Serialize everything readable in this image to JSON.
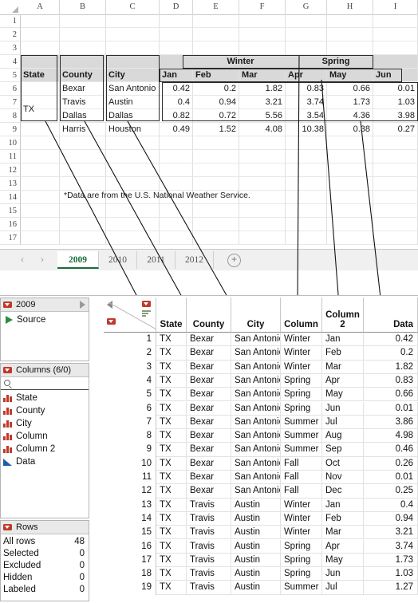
{
  "spreadsheet": {
    "column_headers": [
      "A",
      "B",
      "C",
      "D",
      "E",
      "F",
      "G",
      "H",
      "I"
    ],
    "row_headers": [
      "1",
      "2",
      "3",
      "4",
      "5",
      "6",
      "7",
      "8",
      "9",
      "10",
      "11",
      "12",
      "13",
      "14",
      "15",
      "16",
      "17"
    ],
    "season_headers": [
      {
        "label": "Winter"
      },
      {
        "label": "Spring"
      }
    ],
    "field_headers": [
      "State",
      "County",
      "City"
    ],
    "month_headers": [
      "Jan",
      "Feb",
      "Mar",
      "Apr",
      "May",
      "Jun"
    ],
    "state_value": "TX",
    "rows": [
      {
        "county": "Bexar",
        "city": "San Antonio",
        "values": [
          "0.42",
          "0.2",
          "1.82",
          "0.83",
          "0.66",
          "0.01"
        ]
      },
      {
        "county": "Travis",
        "city": "Austin",
        "values": [
          "0.4",
          "0.94",
          "3.21",
          "3.74",
          "1.73",
          "1.03"
        ]
      },
      {
        "county": "Dallas",
        "city": "Dallas",
        "values": [
          "0.82",
          "0.72",
          "5.56",
          "3.54",
          "4.36",
          "3.98"
        ]
      },
      {
        "county": "Harris",
        "city": "Houston",
        "values": [
          "0.49",
          "1.52",
          "4.08",
          "10.38",
          "0.38",
          "0.27"
        ]
      }
    ],
    "footnote": "*Data are from the U.S. National Weather Service.",
    "sheet_tabs": [
      {
        "label": "2009",
        "active": true
      },
      {
        "label": "2010",
        "active": false
      },
      {
        "label": "2011",
        "active": false
      },
      {
        "label": "2012",
        "active": false
      }
    ],
    "add_sheet_label": "+",
    "nav_prev": "‹",
    "nav_next": "›"
  },
  "jmp": {
    "table_panel": {
      "title": "2009",
      "source_label": "Source"
    },
    "columns_panel": {
      "title": "Columns (6/0)",
      "search_placeholder": "",
      "items": [
        {
          "name": "State",
          "type": "nominal"
        },
        {
          "name": "County",
          "type": "nominal"
        },
        {
          "name": "City",
          "type": "nominal"
        },
        {
          "name": "Column",
          "type": "nominal"
        },
        {
          "name": "Column 2",
          "type": "nominal"
        },
        {
          "name": "Data",
          "type": "continuous"
        }
      ]
    },
    "rows_panel": {
      "title": "Rows",
      "stats": [
        {
          "label": "All rows",
          "value": "48"
        },
        {
          "label": "Selected",
          "value": "0"
        },
        {
          "label": "Excluded",
          "value": "0"
        },
        {
          "label": "Hidden",
          "value": "0"
        },
        {
          "label": "Labeled",
          "value": "0"
        }
      ]
    },
    "grid": {
      "headers": [
        "State",
        "County",
        "City",
        "Column",
        "Column 2",
        "Data"
      ],
      "rows": [
        {
          "n": "1",
          "cells": [
            "TX",
            "Bexar",
            "San Antonio",
            "Winter",
            "Jan",
            "0.42"
          ]
        },
        {
          "n": "2",
          "cells": [
            "TX",
            "Bexar",
            "San Antonio",
            "Winter",
            "Feb",
            "0.2"
          ]
        },
        {
          "n": "3",
          "cells": [
            "TX",
            "Bexar",
            "San Antonio",
            "Winter",
            "Mar",
            "1.82"
          ]
        },
        {
          "n": "4",
          "cells": [
            "TX",
            "Bexar",
            "San Antonio",
            "Spring",
            "Apr",
            "0.83"
          ]
        },
        {
          "n": "5",
          "cells": [
            "TX",
            "Bexar",
            "San Antonio",
            "Spring",
            "May",
            "0.66"
          ]
        },
        {
          "n": "6",
          "cells": [
            "TX",
            "Bexar",
            "San Antonio",
            "Spring",
            "Jun",
            "0.01"
          ]
        },
        {
          "n": "7",
          "cells": [
            "TX",
            "Bexar",
            "San Antonio",
            "Summer",
            "Jul",
            "3.86"
          ]
        },
        {
          "n": "8",
          "cells": [
            "TX",
            "Bexar",
            "San Antonio",
            "Summer",
            "Aug",
            "4.98"
          ]
        },
        {
          "n": "9",
          "cells": [
            "TX",
            "Bexar",
            "San Antonio",
            "Summer",
            "Sep",
            "0.46"
          ]
        },
        {
          "n": "10",
          "cells": [
            "TX",
            "Bexar",
            "San Antonio",
            "Fall",
            "Oct",
            "0.26"
          ]
        },
        {
          "n": "11",
          "cells": [
            "TX",
            "Bexar",
            "San Antonio",
            "Fall",
            "Nov",
            "0.01"
          ]
        },
        {
          "n": "12",
          "cells": [
            "TX",
            "Bexar",
            "San Antonio",
            "Fall",
            "Dec",
            "0.25"
          ]
        },
        {
          "n": "13",
          "cells": [
            "TX",
            "Travis",
            "Austin",
            "Winter",
            "Jan",
            "0.4"
          ]
        },
        {
          "n": "14",
          "cells": [
            "TX",
            "Travis",
            "Austin",
            "Winter",
            "Feb",
            "0.94"
          ]
        },
        {
          "n": "15",
          "cells": [
            "TX",
            "Travis",
            "Austin",
            "Winter",
            "Mar",
            "3.21"
          ]
        },
        {
          "n": "16",
          "cells": [
            "TX",
            "Travis",
            "Austin",
            "Spring",
            "Apr",
            "3.74"
          ]
        },
        {
          "n": "17",
          "cells": [
            "TX",
            "Travis",
            "Austin",
            "Spring",
            "May",
            "1.73"
          ]
        },
        {
          "n": "18",
          "cells": [
            "TX",
            "Travis",
            "Austin",
            "Spring",
            "Jun",
            "1.03"
          ]
        },
        {
          "n": "19",
          "cells": [
            "TX",
            "Travis",
            "Austin",
            "Summer",
            "Jul",
            "1.27"
          ]
        }
      ]
    }
  },
  "colors": {
    "accent_green": "#1b6b3a",
    "nominal_red": "#c0392b",
    "continuous_blue": "#1f5fa8",
    "shade_gray": "#d9d9d9"
  }
}
